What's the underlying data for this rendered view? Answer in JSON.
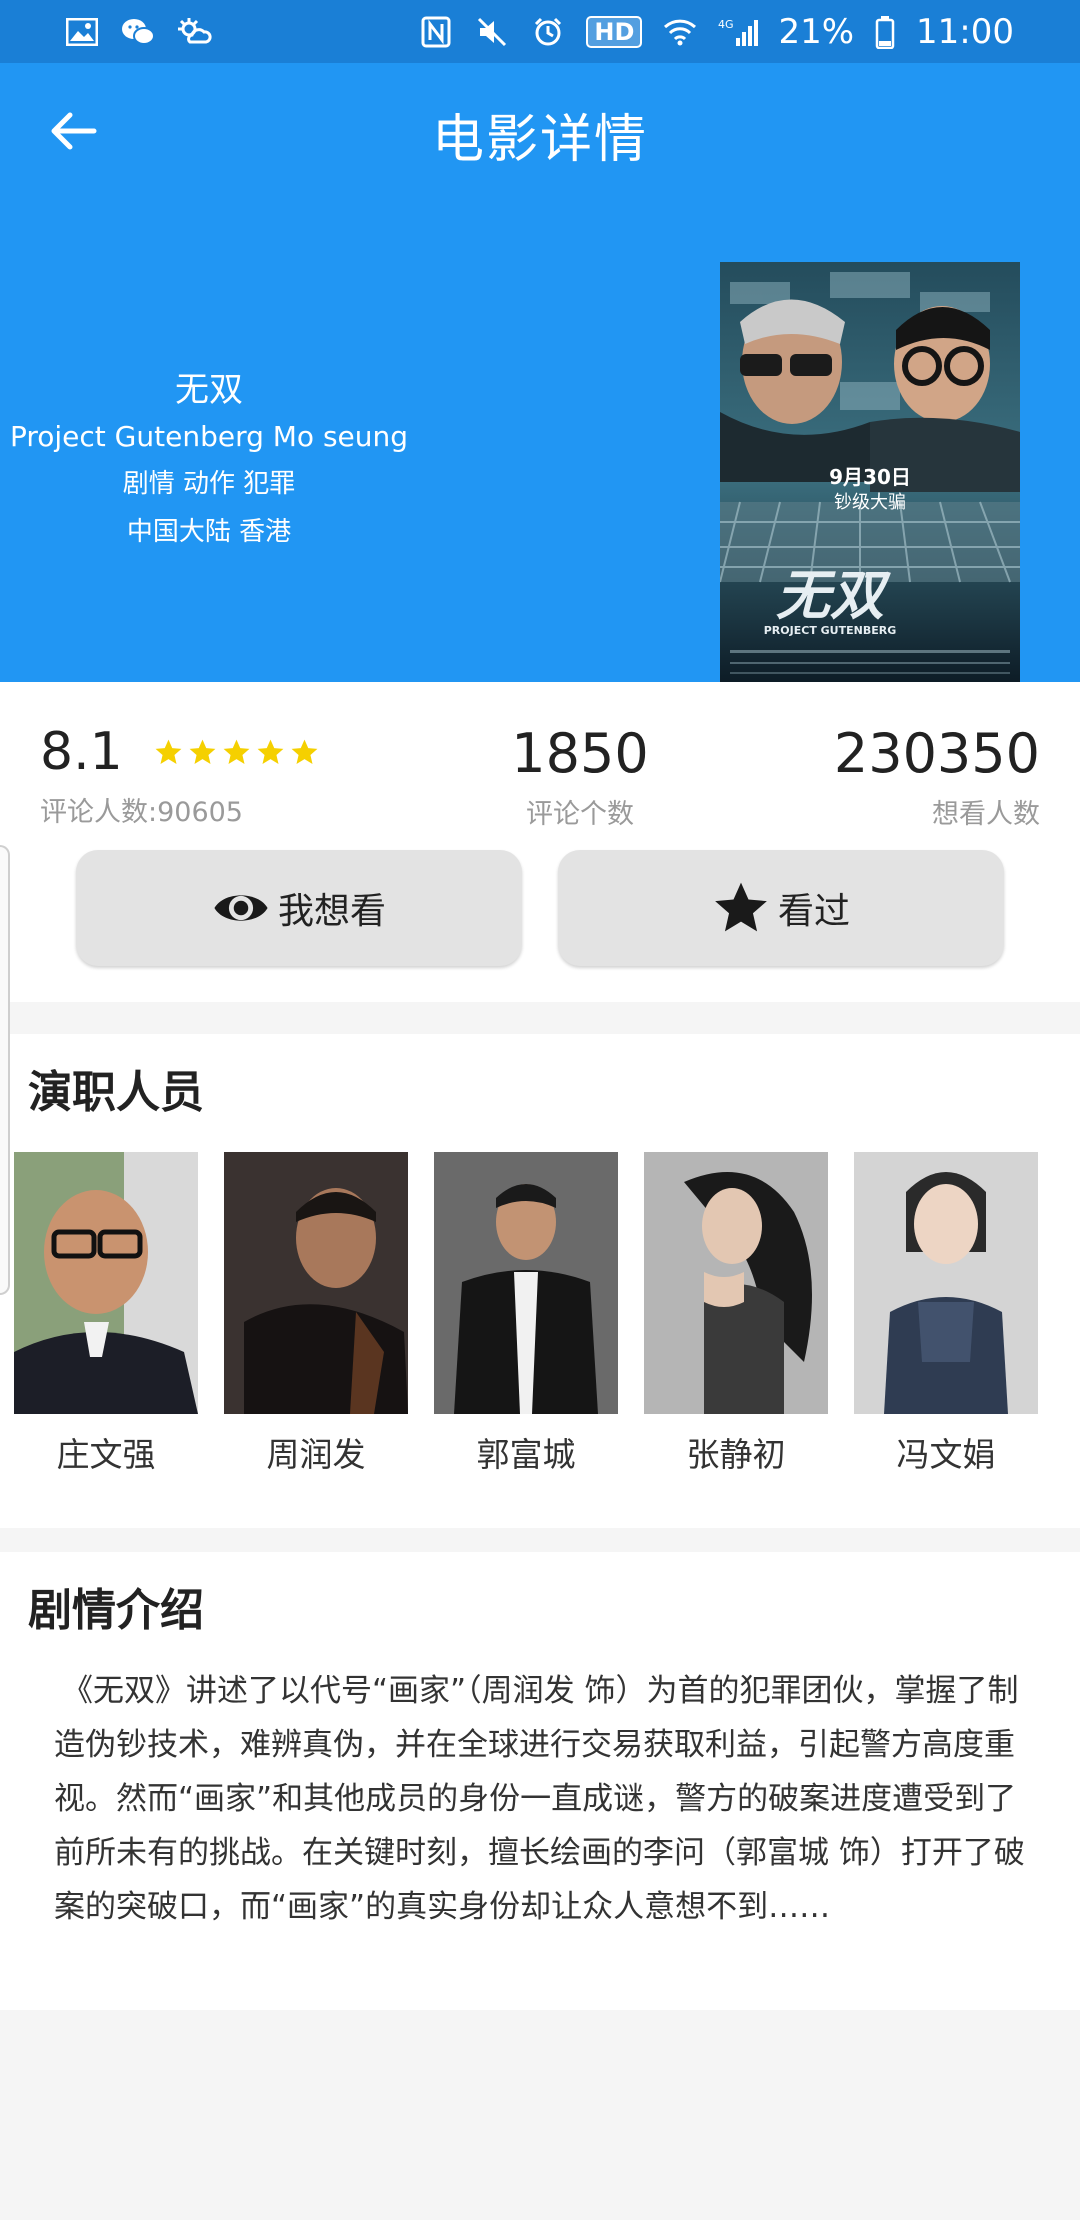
{
  "status_bar": {
    "battery": "21%",
    "time": "11:00",
    "hd": "HD",
    "network": "4G",
    "icons": [
      "gallery-icon",
      "wechat-icon",
      "weather-icon",
      "nfc-icon",
      "mute-icon",
      "alarm-icon",
      "wifi-icon",
      "signal-icon",
      "battery-icon"
    ]
  },
  "app_bar": {
    "title": "电影详情",
    "back_icon": "back-arrow-icon"
  },
  "movie": {
    "name": "无双",
    "english_name": "Project Gutenberg Mo seung",
    "genres": "剧情 动作 犯罪",
    "regions": "中国大陆 香港",
    "poster": {
      "date": "9月30日",
      "tagline": "钞级大骗",
      "title": "无双",
      "subtitle": "PROJECT GUTENBERG"
    }
  },
  "stats": {
    "rating": "8.1",
    "stars_filled": 5,
    "stars_total": 5,
    "rating_count_label": "评论人数:90605",
    "comments": "1850",
    "comments_label": "评论个数",
    "want_count": "230350",
    "want_label": "想看人数"
  },
  "actions": {
    "want_label": "我想看",
    "want_icon": "eye-icon",
    "seen_label": "看过",
    "seen_icon": "star-icon"
  },
  "cast": {
    "title": "演职人员",
    "members": [
      {
        "name": "庄文强"
      },
      {
        "name": "周润发"
      },
      {
        "name": "郭富城"
      },
      {
        "name": "张静初"
      },
      {
        "name": "冯文娟"
      }
    ]
  },
  "plot": {
    "title": "剧情介绍",
    "text": "《无双》讲述了以代号“画家”（周润发 饰）为首的犯罪团伙，掌握了制造伪钞技术，难辨真伪，并在全球进行交易获取利益，引起警方高度重视。然而“画家”和其他成员的身份一直成谜，警方的破案进度遭受到了前所未有的挑战。在关键时刻，擅长绘画的李问（郭富城 饰）打开了破案的突破口，而“画家”的真实身份却让众人意想不到……"
  },
  "colors": {
    "primary": "#2196f3",
    "status_bar": "#1a7fd6",
    "star": "#f5d000",
    "button_bg": "#e3e3e3"
  }
}
